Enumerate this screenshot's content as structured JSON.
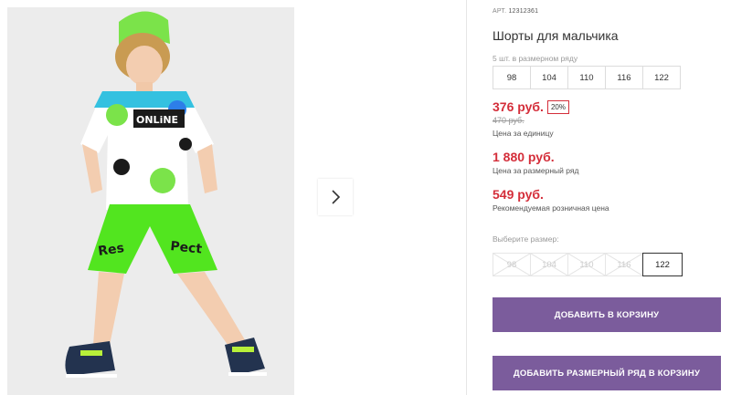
{
  "gallery": {
    "next_icon": "chevron-right-icon",
    "print_text_1": "ONLiNE",
    "print_text_2": "Pect",
    "print_text_3": "Res"
  },
  "product": {
    "art_label": "АРТ.",
    "art_number": "12312361",
    "title": "Шорты для мальчика",
    "pack_note": "5 шт. в размерном ряду",
    "pack_sizes": [
      "98",
      "104",
      "110",
      "116",
      "122"
    ],
    "price": "376 руб.",
    "discount": "20%",
    "old_price": "470 руб.",
    "unit_label": "Цена за единицу",
    "row_price": "1 880 руб.",
    "row_label": "Цена за размерный ряд",
    "retail_price": "549 руб.",
    "retail_label": "Рекомендуемая розничная цена",
    "choose_label": "Выберите размер:",
    "size_options": [
      "98",
      "104",
      "110",
      "116",
      "122"
    ],
    "selected_size": "122",
    "add_to_cart": "ДОБАВИТЬ В КОРЗИНУ",
    "add_row_to_cart": "ДОБАВИТЬ РАЗМЕРНЫЙ РЯД В КОРЗИНУ"
  },
  "colors": {
    "accent_price": "#d42e3a",
    "button": "#7b5c9c"
  }
}
